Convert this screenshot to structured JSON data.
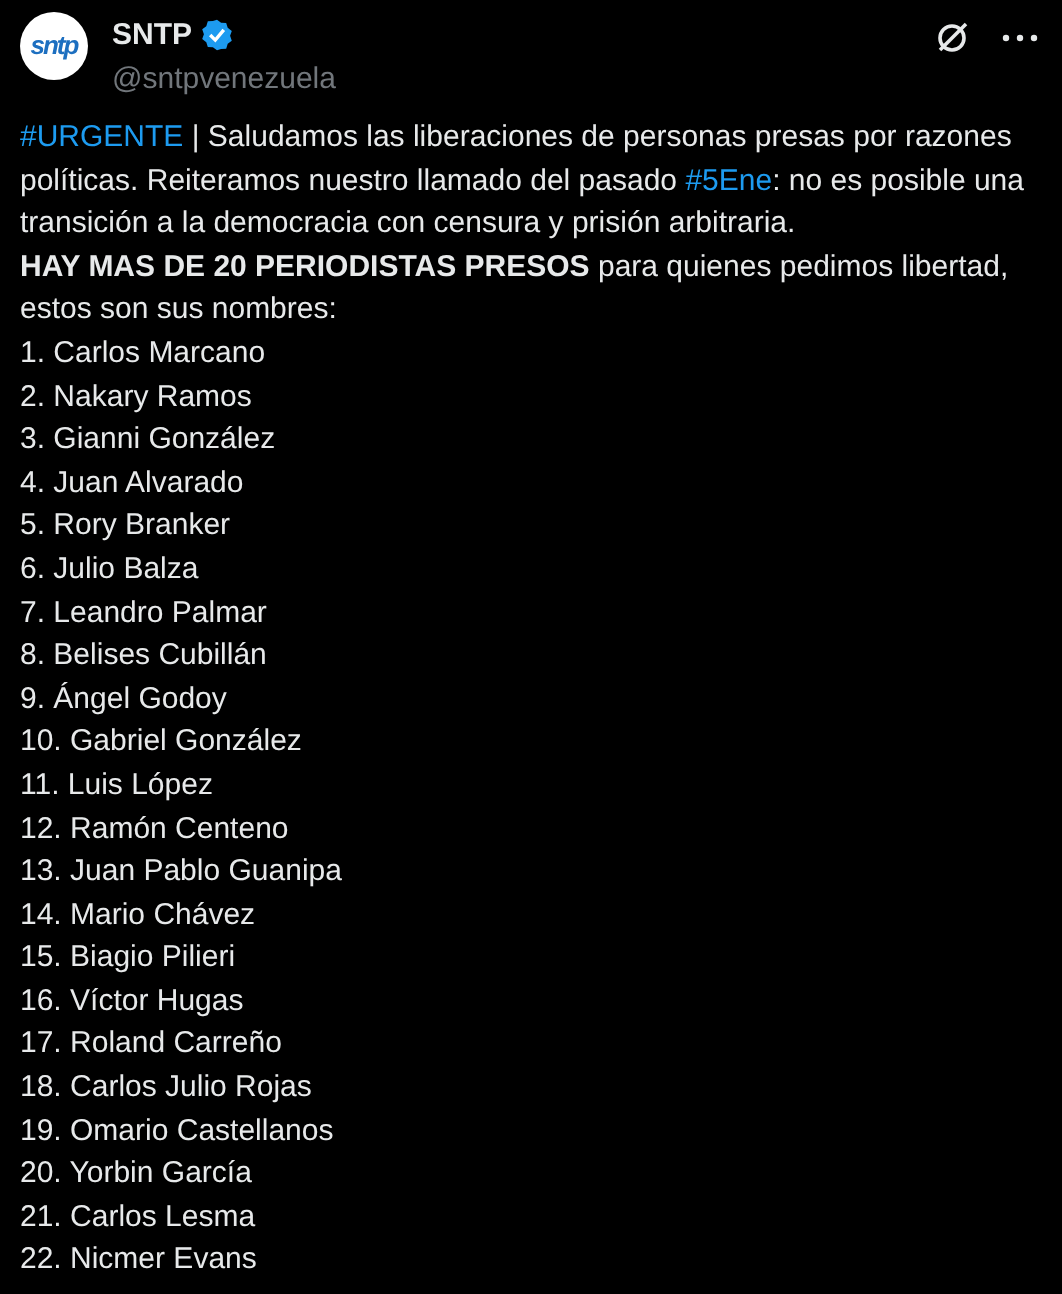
{
  "author": {
    "name": "SNTP",
    "verified": true,
    "handle": "@sntpvenezuela",
    "avatar_text": "sntp"
  },
  "intro": [
    {
      "kind": "hashtag",
      "text": "#URGENTE"
    },
    {
      "kind": "text",
      "text": " | Saludamos las liberaciones de personas presas por razones políticas. Reiteramos nuestro llamado del pasado "
    },
    {
      "kind": "hashtag",
      "text": "#5Ene"
    },
    {
      "kind": "text",
      "text": ": no es posible una transición a la democracia con censura y prisión arbitraria."
    }
  ],
  "lead": "**HAY MAS DE 20 PERIODISTAS PRESOS** para quienes pedimos libertad, estos son sus nombres:",
  "names": [
    "1. Carlos Marcano",
    "2. Nakary Ramos",
    "3. Gianni González",
    "4. Juan Alvarado",
    "5. Rory Branker",
    "6. Julio Balza",
    "7. Leandro Palmar",
    "8. Belises Cubillán",
    "9. Ángel Godoy",
    "10. Gabriel González",
    "11. Luis López",
    "12. Ramón Centeno",
    "13. Juan Pablo Guanipa",
    "14. Mario Chávez",
    "15. Biagio Pilieri",
    "16. Víctor Hugas",
    "17. Roland Carreño",
    "18. Carlos Julio Rojas",
    "19. Omario Castellanos",
    "20. Yorbin García",
    "21. Carlos Lesma",
    "22. Nicmer Evans"
  ]
}
